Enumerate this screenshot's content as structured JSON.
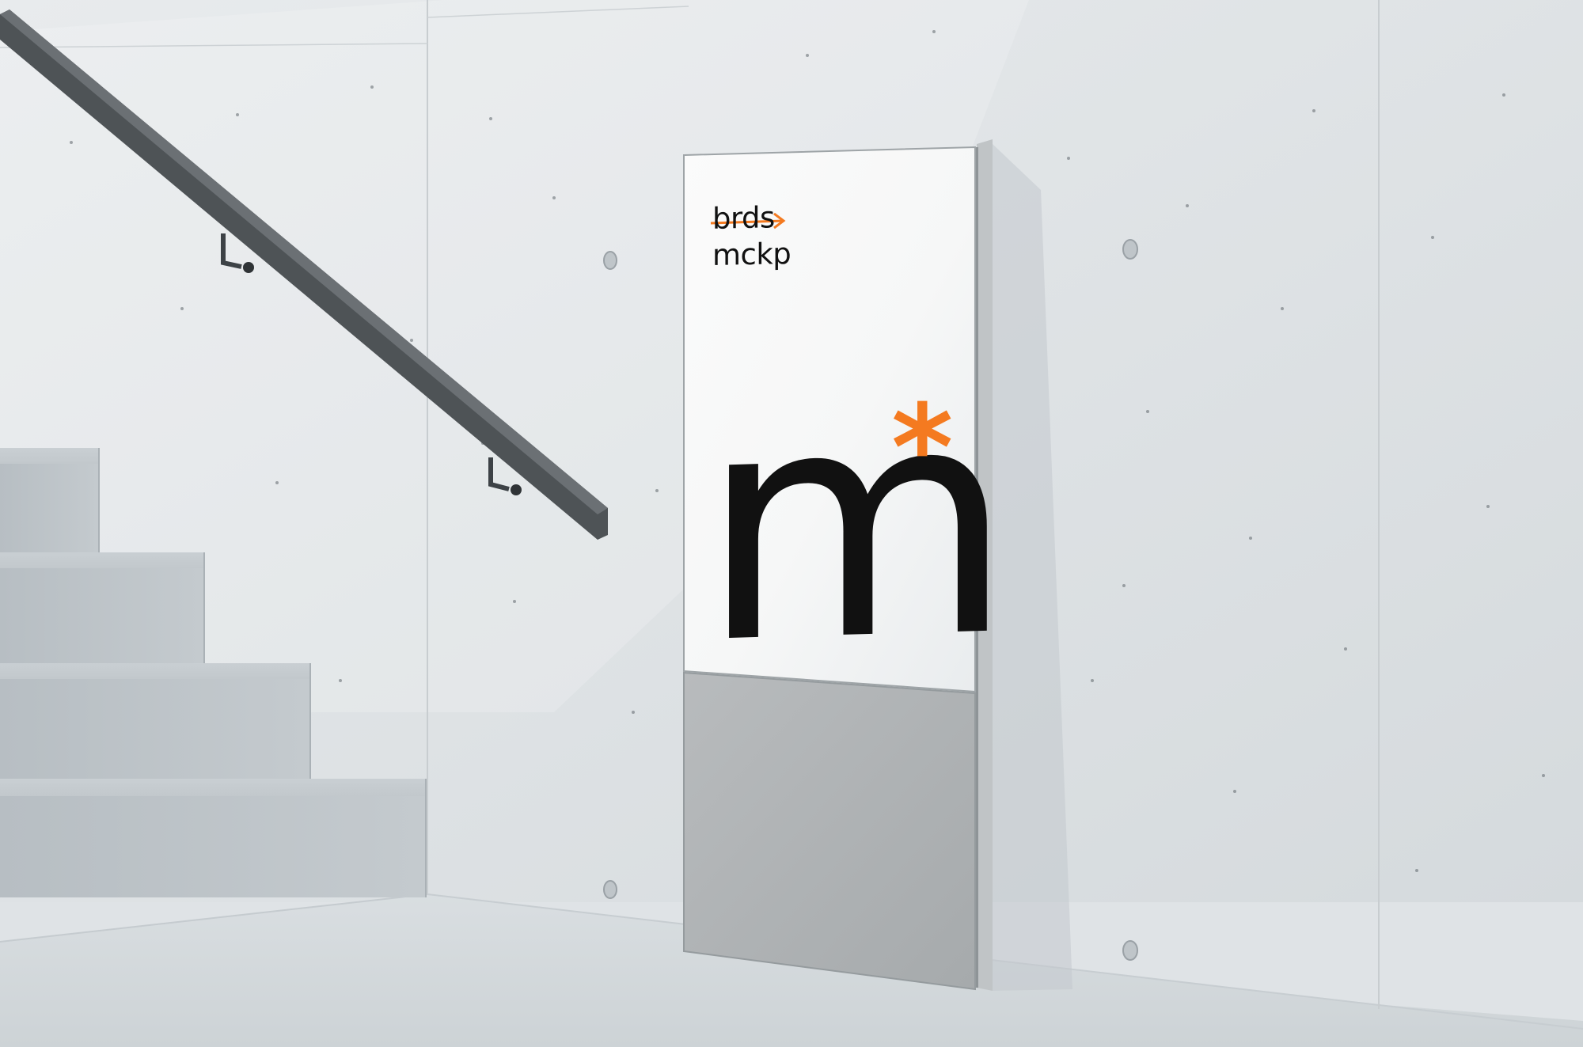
{
  "sign": {
    "brand_line1": "brds",
    "brand_line2": "mckp",
    "logo_letter": "m",
    "logo_mark": "*"
  },
  "colors": {
    "wall": "#dfe3e6",
    "accent": "#f47a20",
    "ink": "#111111",
    "sign_panel": "#f4f5f5",
    "sign_base": "#b3b6b7",
    "rail": "#55595c"
  }
}
